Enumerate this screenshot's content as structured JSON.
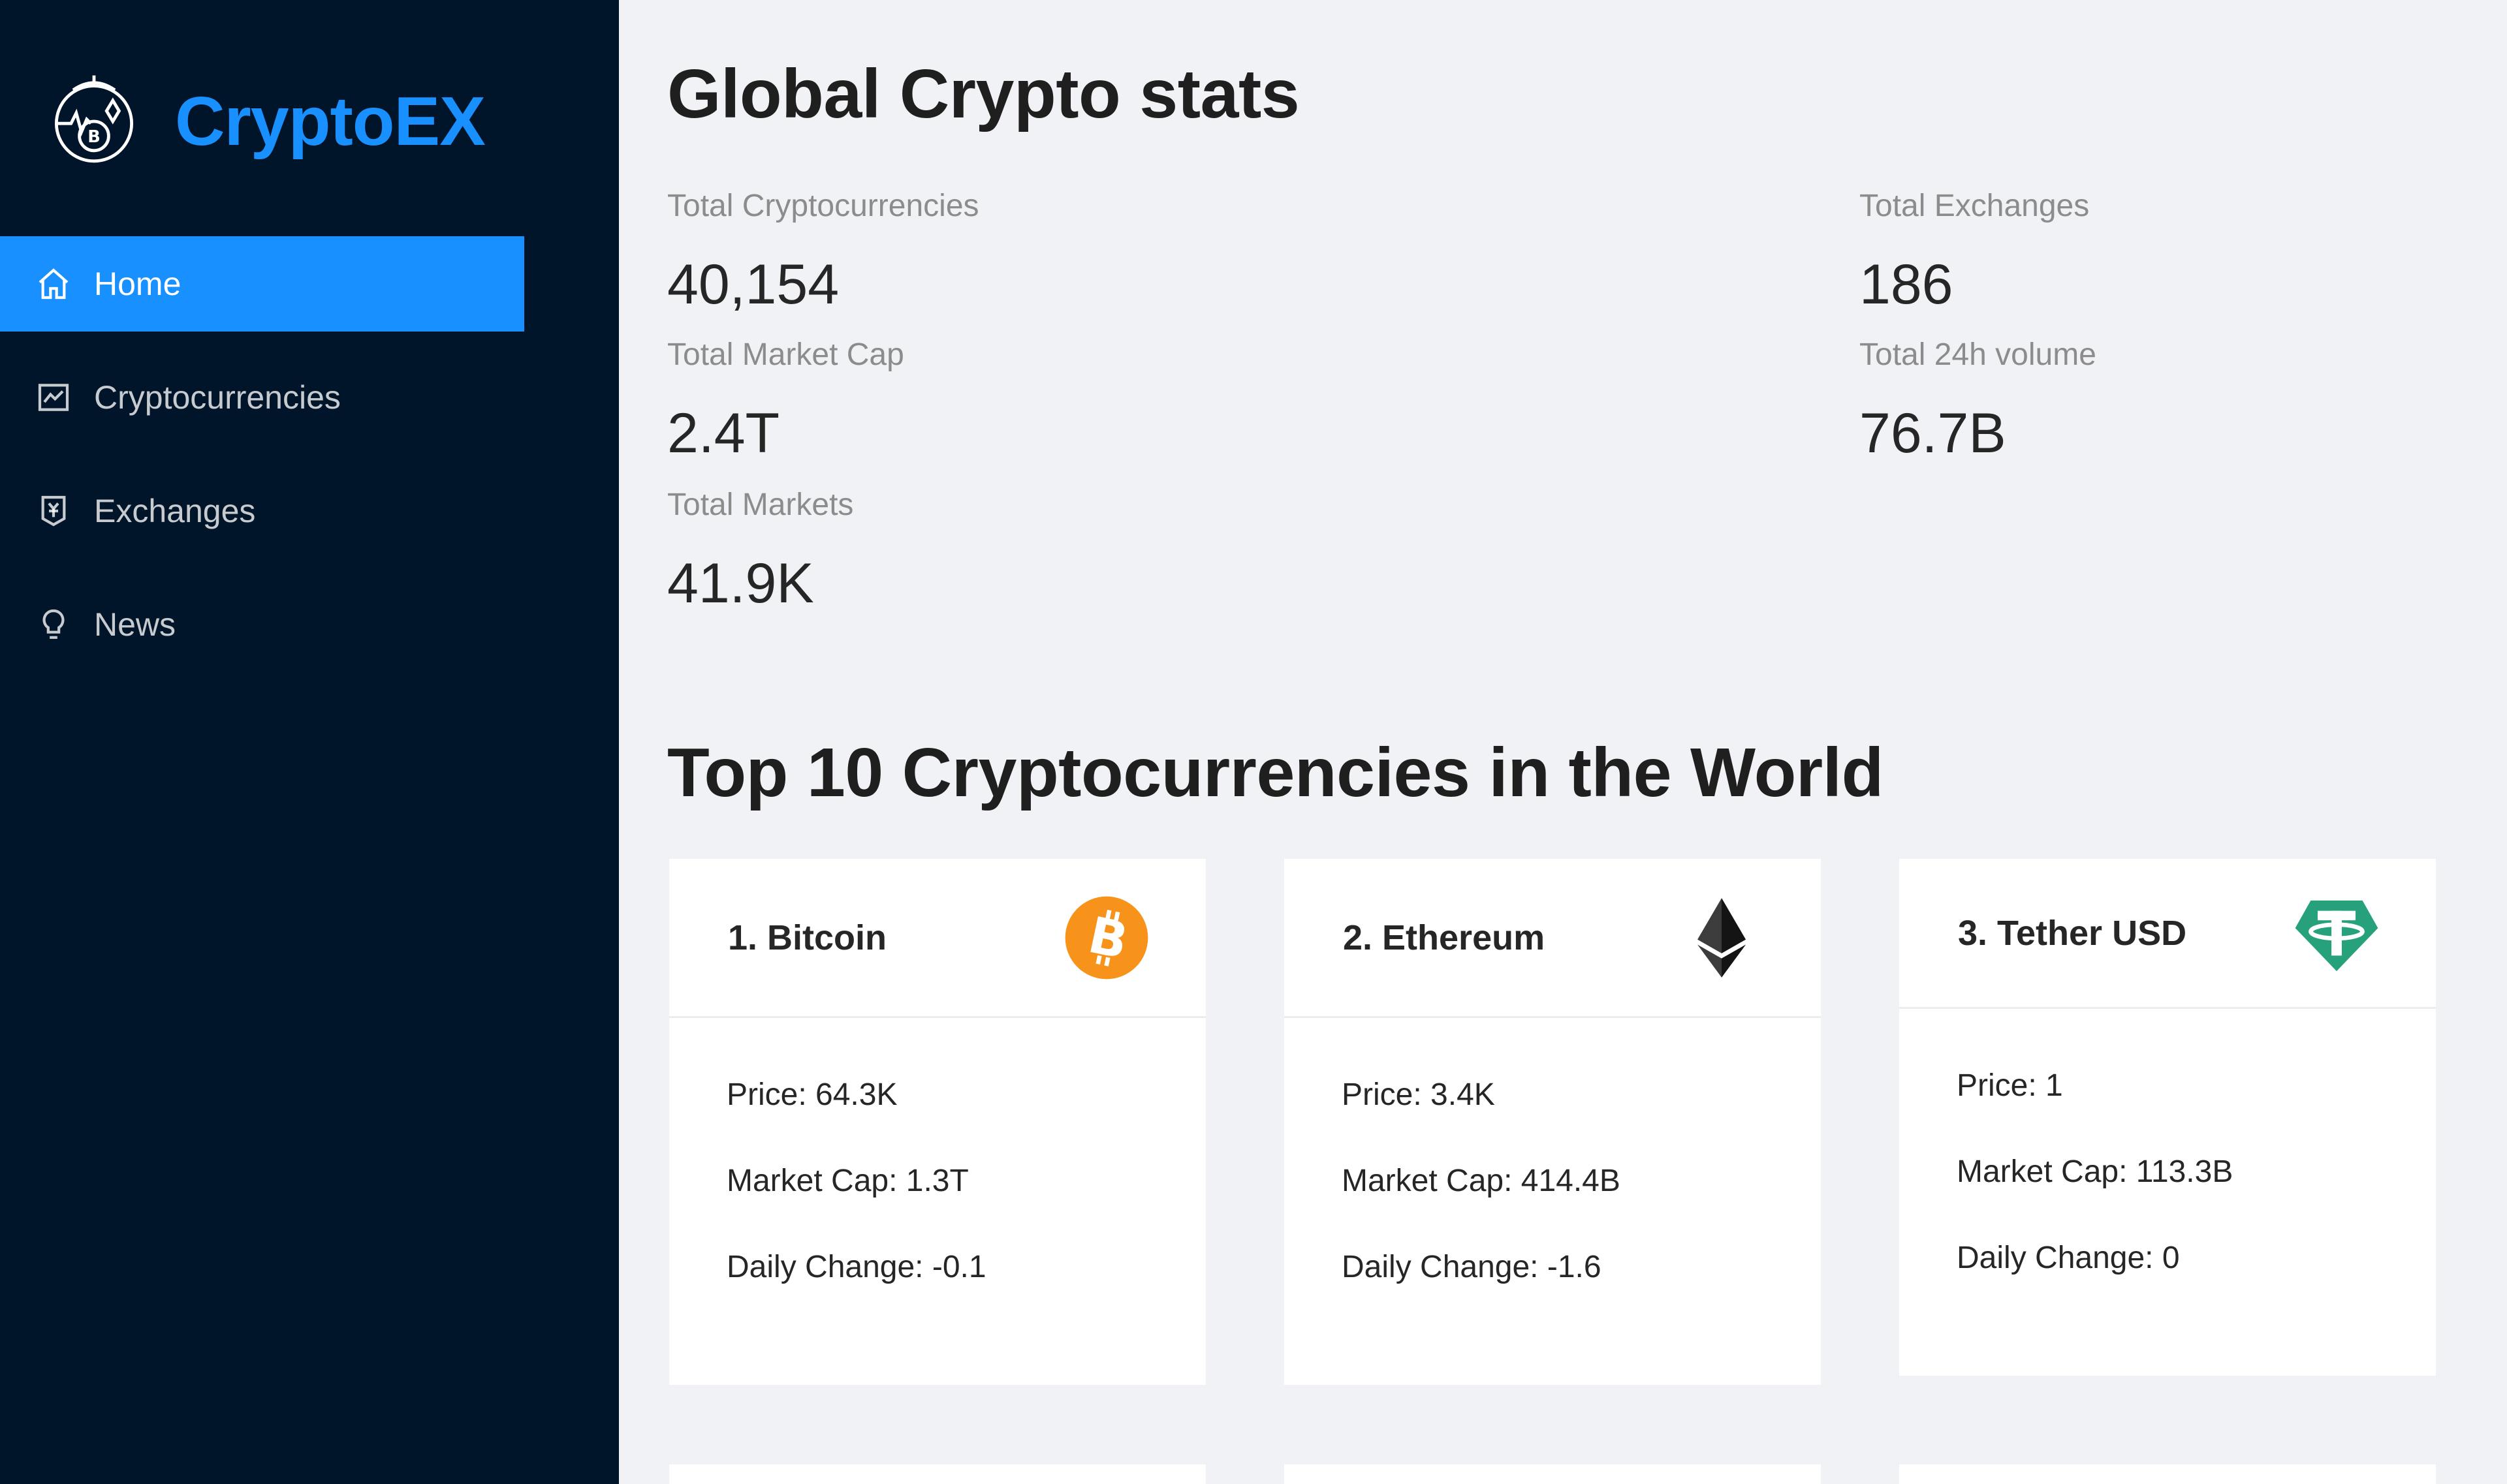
{
  "brand": {
    "title": "CryptoEX"
  },
  "sidebar": {
    "items": [
      {
        "label": "Home",
        "icon": "home-icon",
        "active": true
      },
      {
        "label": "Cryptocurrencies",
        "icon": "line-chart-icon",
        "active": false
      },
      {
        "label": "Exchanges",
        "icon": "money-collect-icon",
        "active": false
      },
      {
        "label": "News",
        "icon": "bulb-icon",
        "active": false
      }
    ]
  },
  "stats": {
    "heading": "Global Crypto stats",
    "total_cryptocurrencies": {
      "label": "Total Cryptocurrencies",
      "value": "40,154"
    },
    "total_exchanges": {
      "label": "Total Exchanges",
      "value": "186"
    },
    "total_market_cap": {
      "label": "Total Market Cap",
      "value": "2.4T"
    },
    "total_24h_volume": {
      "label": "Total 24h volume",
      "value": "76.7B"
    },
    "total_markets": {
      "label": "Total Markets",
      "value": "41.9K"
    }
  },
  "top": {
    "heading": "Top 10 Cryptocurrencies in the World",
    "cards": [
      {
        "title": "1. Bitcoin",
        "icon": "bitcoin-icon",
        "price": "Price: 64.3K",
        "market_cap": "Market Cap: 1.3T",
        "daily_change": "Daily Change: -0.1"
      },
      {
        "title": "2. Ethereum",
        "icon": "ethereum-icon",
        "price": "Price: 3.4K",
        "market_cap": "Market Cap: 414.4B",
        "daily_change": "Daily Change: -1.6"
      },
      {
        "title": "3. Tether USD",
        "icon": "tether-icon",
        "price": "Price: 1",
        "market_cap": "Market Cap: 113.3B",
        "daily_change": "Daily Change: 0"
      }
    ]
  },
  "colors": {
    "sidebar_bg": "#001529",
    "accent": "#1890ff",
    "page_bg": "#f0f2f5",
    "bitcoin": "#f7931a",
    "tether": "#26a17b"
  }
}
